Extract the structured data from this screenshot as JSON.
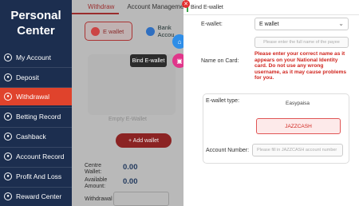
{
  "sidebar": {
    "title_line1": "Personal",
    "title_line2": "Center",
    "items": [
      {
        "label": "My Account",
        "icon": "user-icon",
        "active": false
      },
      {
        "label": "Deposit",
        "icon": "deposit-icon",
        "active": false
      },
      {
        "label": "Withdrawal",
        "icon": "withdrawal-icon",
        "active": true
      },
      {
        "label": "Betting Record",
        "icon": "betting-record-icon",
        "active": false
      },
      {
        "label": "Cashback",
        "icon": "cashback-icon",
        "active": false
      },
      {
        "label": "Account Record",
        "icon": "account-record-icon",
        "active": false
      },
      {
        "label": "Profit And Loss",
        "icon": "profit-loss-icon",
        "active": false
      },
      {
        "label": "Reward Center",
        "icon": "reward-icon",
        "active": false
      }
    ]
  },
  "main": {
    "tabs": [
      {
        "label": "Withdraw",
        "active": true
      },
      {
        "label": "Account Management",
        "active": false
      }
    ],
    "wallet_buttons": {
      "ewallet": "E wallet",
      "bank": "Bank Accou"
    },
    "empty_text": "Empty E-Wallet",
    "add_wallet": "+ Add wallet",
    "balances": [
      {
        "label_line1": "Centre",
        "label_line2": "Wallet:",
        "value": "0.00"
      },
      {
        "label_line1": "Available",
        "label_line2": "Amount:",
        "value": "0.00"
      }
    ],
    "withdraw_label": "Withdrawal"
  },
  "tooltip": "Bind E-wallet",
  "dialog": {
    "title": "Bind E-wallet",
    "ewallet_label": "E-wallet:",
    "ewallet_value": "E wallet",
    "name_label": "Name on Card:",
    "name_placeholder": "Please enter the full name of the payee",
    "warning": "Please enter your correct name as it appears on your National Identity card. Do not use any wrong username, as it may cause problems for you.",
    "type_label": "E-wallet type:",
    "options": [
      "Easypaisa",
      "JAZZCASH"
    ],
    "selected_option": "JAZZCASH",
    "account_label": "Account Number:",
    "account_placeholder": "Please fill in JAZZCASH account number"
  },
  "colors": {
    "sidebar_bg": "#1c2e4f",
    "active_red": "#e0432c",
    "warning_red": "#d0251e"
  }
}
